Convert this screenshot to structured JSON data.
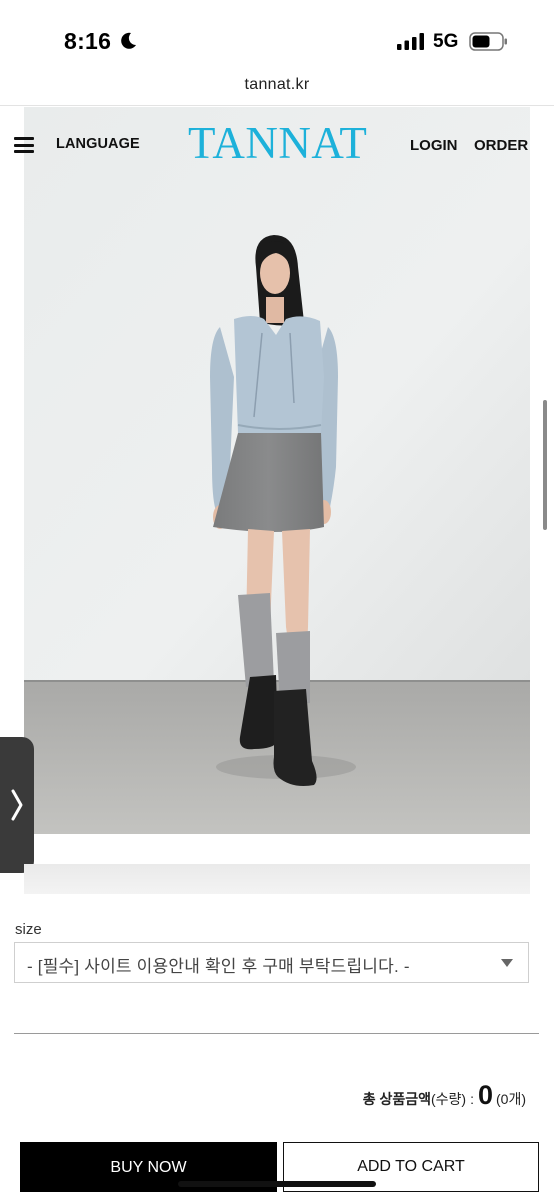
{
  "status_bar": {
    "time": "8:16",
    "network": "5G",
    "icons": [
      "moon-icon",
      "signal-icon",
      "battery-icon"
    ]
  },
  "browser": {
    "url": "tannat.kr"
  },
  "header": {
    "menu_icon": "hamburger-menu-icon",
    "language": "LANGUAGE",
    "logo": "TANNAT",
    "login": "LOGIN",
    "order": "ORDER",
    "logo_color": "#1db1da"
  },
  "product": {
    "image_icon": "product-photo",
    "slide_icon": "chevron-right-icon"
  },
  "options": {
    "size_label": "size",
    "size_selected": "- [필수] 사이트 이용안내 확인 후 구매 부탁드립니다. -"
  },
  "total": {
    "label": "총 상품금액",
    "qty_label": "(수량)",
    "colon": ":",
    "amount": "0",
    "count": "(0개)"
  },
  "actions": {
    "buy_now": "BUY NOW",
    "add_to_cart": "ADD TO CART"
  }
}
